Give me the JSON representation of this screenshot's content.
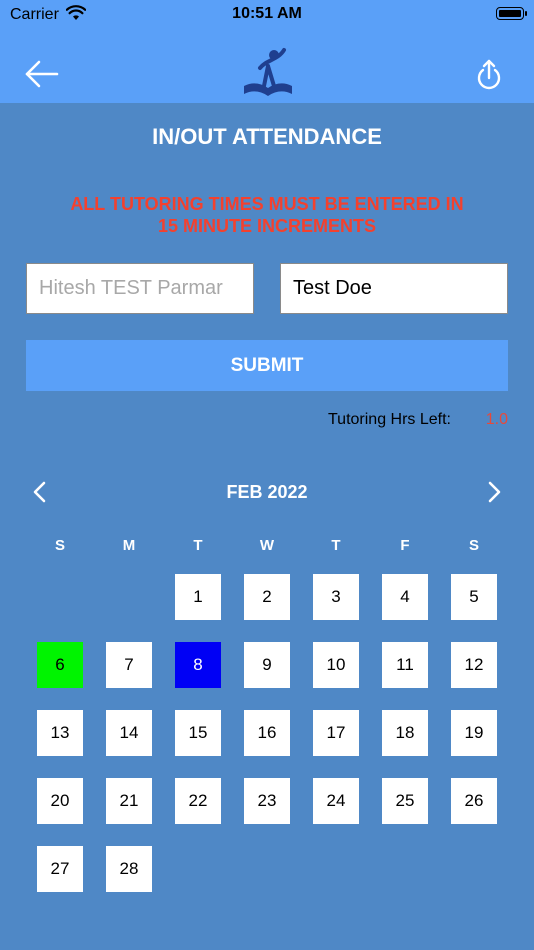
{
  "status": {
    "carrier": "Carrier",
    "time": "10:51 AM"
  },
  "colors": {
    "nav_bg": "#5aa0f8",
    "page_bg": "#4f88c6",
    "warning": "#f3412e",
    "today": "#00f400",
    "selected": "#0000f5"
  },
  "icons": {
    "back": "arrow-left-icon",
    "share": "share-icon",
    "logo": "reader-book-logo",
    "prev": "chevron-left-icon",
    "next": "chevron-right-icon"
  },
  "page": {
    "title": "IN/OUT ATTENDANCE",
    "warning_line1": "ALL TUTORING TIMES MUST BE ENTERED IN",
    "warning_line2": "15 MINUTE INCREMENTS"
  },
  "form": {
    "name_placeholder": "Hitesh TEST Parmar",
    "student_value": "Test Doe",
    "submit_label": "SUBMIT",
    "hrs_label": "Tutoring Hrs Left:",
    "hrs_value": "1.0"
  },
  "calendar": {
    "month_label": "FEB 2022",
    "weekdays": [
      "S",
      "M",
      "T",
      "W",
      "T",
      "F",
      "S"
    ],
    "first_weekday": 2,
    "days": [
      "1",
      "2",
      "3",
      "4",
      "5",
      "6",
      "7",
      "8",
      "9",
      "10",
      "11",
      "12",
      "13",
      "14",
      "15",
      "16",
      "17",
      "18",
      "19",
      "20",
      "21",
      "22",
      "23",
      "24",
      "25",
      "26",
      "27",
      "28"
    ],
    "highlight_green": "6",
    "highlight_blue": "8"
  }
}
